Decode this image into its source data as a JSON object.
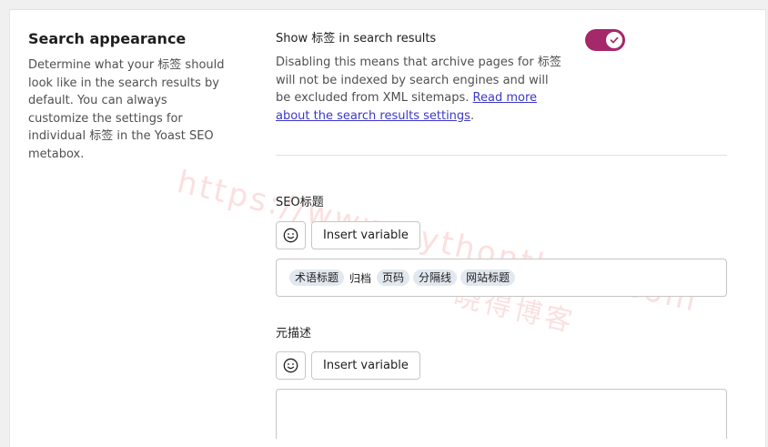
{
  "section": {
    "title": "Search appearance",
    "description": "Determine what your 标签 should look like in the search results by default. You can always customize the settings for individual 标签 in the Yoast SEO metabox."
  },
  "toggle": {
    "label": "Show 标签 in search results",
    "description": "Disabling this means that archive pages for 标签 will not be indexed by search engines and will be excluded from XML sitemaps.",
    "link_text": "Read more about the search results settings",
    "trailing": ".",
    "enabled": true,
    "color": "#a4286a"
  },
  "seo_title": {
    "label": "SEO标题",
    "insert_variable": "Insert variable",
    "chips": [
      "术语标题",
      "归档",
      "页码",
      "分隔线",
      "网站标题"
    ]
  },
  "meta_description": {
    "label": "元描述",
    "insert_variable": "Insert variable",
    "value": ""
  },
  "watermark": {
    "url": "https://www.pythonthree.com",
    "name": "晓得博客"
  }
}
